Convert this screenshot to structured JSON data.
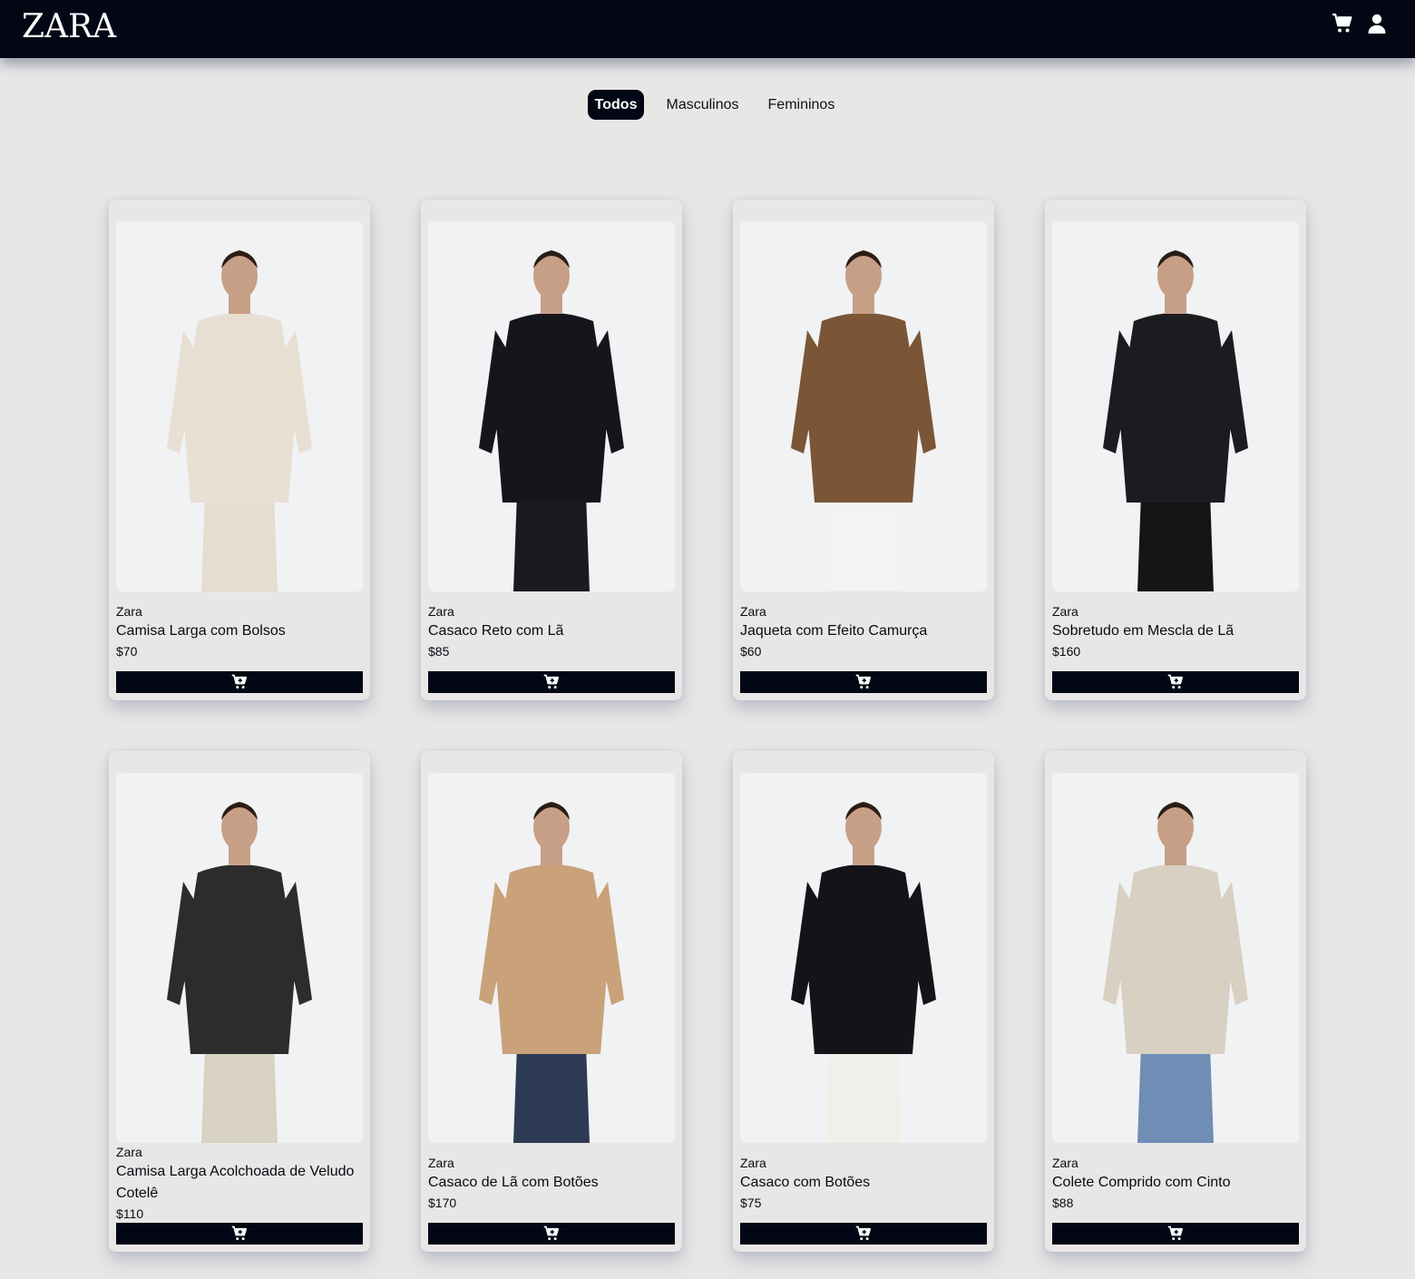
{
  "header": {
    "logo": "ZARA",
    "icons": [
      "cart-icon",
      "user-icon"
    ],
    "background": "#030615"
  },
  "filters": {
    "items": [
      "Todos",
      "Masculinos",
      "Femininos"
    ],
    "active": "Todos"
  },
  "products": [
    {
      "brand": "Zara",
      "name": "Camisa Larga com Bolsos",
      "price": "$70",
      "garment_color": "#e7e0d3",
      "bottom_color": "#e4ddd0"
    },
    {
      "brand": "Zara",
      "name": "Casaco Reto com Lã",
      "price": "$85",
      "garment_color": "#15161c",
      "bottom_color": "#1a1a20"
    },
    {
      "brand": "Zara",
      "name": "Jaqueta com Efeito Camurça",
      "price": "$60",
      "garment_color": "#7a5636",
      "bottom_color": "#f3f3f3"
    },
    {
      "brand": "Zara",
      "name": "Sobretudo em Mescla de Lã",
      "price": "$160",
      "garment_color": "#1b1c20",
      "bottom_color": "#151518"
    },
    {
      "brand": "Zara",
      "name": "Camisa Larga Acolchoada de Veludo Cotelê",
      "price": "$110",
      "garment_color": "#2c2c2a",
      "bottom_color": "#d8d2c2"
    },
    {
      "brand": "Zara",
      "name": "Casaco de Lã com Botões",
      "price": "$170",
      "garment_color": "#c9a27a",
      "bottom_color": "#2e3b55"
    },
    {
      "brand": "Zara",
      "name": "Casaco com Botões",
      "price": "$75",
      "garment_color": "#141418",
      "bottom_color": "#f1efe9"
    },
    {
      "brand": "Zara",
      "name": "Colete Comprido com Cinto",
      "price": "$88",
      "garment_color": "#d8d0c2",
      "bottom_color": "#6f8db5"
    }
  ],
  "cart_button_icon": "add-to-cart-icon"
}
